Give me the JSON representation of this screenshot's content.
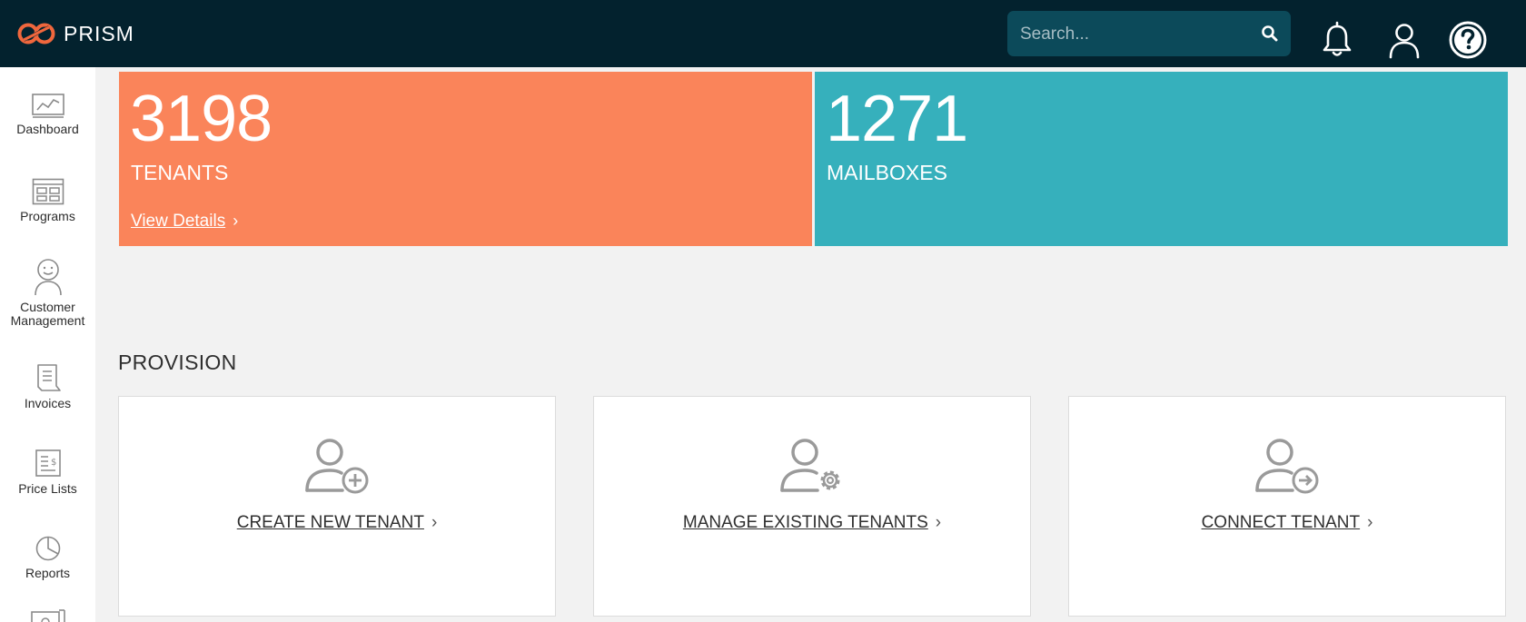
{
  "brand": {
    "name": "PRISM",
    "logo_color": "#f0673d"
  },
  "search": {
    "placeholder": "Search..."
  },
  "header_icons": [
    "search-icon",
    "bell-icon",
    "user-icon",
    "help-icon"
  ],
  "sidebar": {
    "items": [
      {
        "id": "dashboard",
        "label": "Dashboard",
        "icon": "chart-icon"
      },
      {
        "id": "programs",
        "label": "Programs",
        "icon": "grid-icon"
      },
      {
        "id": "customer-management",
        "label": "Customer Management",
        "icon": "person-smile-icon"
      },
      {
        "id": "invoices",
        "label": "Invoices",
        "icon": "document-icon"
      },
      {
        "id": "price-lists",
        "label": "Price Lists",
        "icon": "price-doc-icon"
      },
      {
        "id": "reports",
        "label": "Reports",
        "icon": "pie-icon"
      }
    ]
  },
  "stats": {
    "tenants": {
      "value": "3198",
      "label": "TENANTS",
      "link": "View Details",
      "color": "#fa845a"
    },
    "mailboxes": {
      "value": "1271",
      "label": "MAILBOXES",
      "color": "#36b0bc"
    }
  },
  "provision": {
    "title": "PROVISION",
    "cards": [
      {
        "id": "create",
        "label": "CREATE NEW TENANT",
        "icon": "user-add-icon"
      },
      {
        "id": "manage",
        "label": "MANAGE EXISTING TENANTS",
        "icon": "user-gear-icon"
      },
      {
        "id": "connect",
        "label": "CONNECT TENANT",
        "icon": "user-connect-icon"
      }
    ]
  }
}
